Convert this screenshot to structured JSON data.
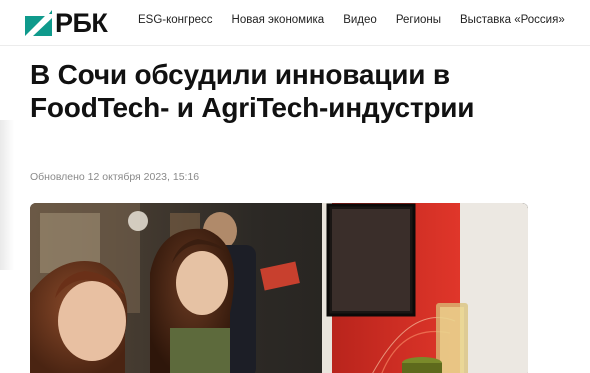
{
  "brand": {
    "logo_text": "РБК"
  },
  "nav": {
    "items": [
      {
        "label": "ESG-конгресс"
      },
      {
        "label": "Новая экономика"
      },
      {
        "label": "Видео"
      },
      {
        "label": "Регионы"
      },
      {
        "label": "Выставка «Россия»"
      }
    ]
  },
  "article": {
    "title": "В Сочи обсудили инновации в FoodTech- и AgriTech-индустрии",
    "updated": "Обновлено 12 октября 2023, 15:16"
  },
  "colors": {
    "brand_green": "#0f9a8c",
    "text": "#111111",
    "muted": "#8a8a8a"
  }
}
